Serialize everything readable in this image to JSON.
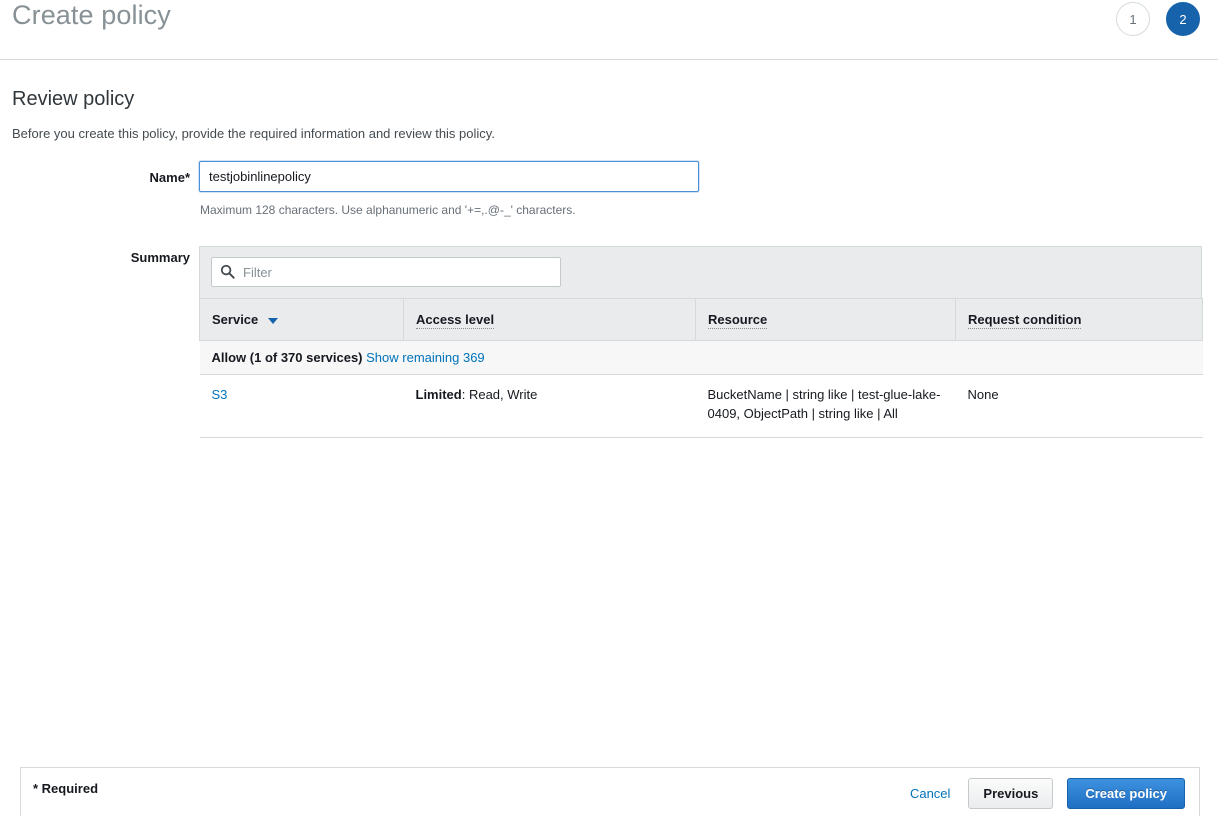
{
  "header": {
    "title": "Create policy",
    "steps": [
      {
        "label": "1",
        "state": "inactive"
      },
      {
        "label": "2",
        "state": "active"
      }
    ],
    "accent_color": "#1763ab",
    "title_color": "#879196"
  },
  "section": {
    "title": "Review policy",
    "description": "Before you create this policy, provide the required information and review this policy."
  },
  "form": {
    "name_label": "Name*",
    "name_value": "testjobinlinepolicy",
    "name_placeholder": "",
    "name_hint": "Maximum 128 characters. Use alphanumeric and '+=,.@-_' characters.",
    "summary_label": "Summary"
  },
  "summary": {
    "filter_placeholder": "Filter",
    "filter_value": "",
    "filter_icon": "search-icon",
    "columns": [
      {
        "label": "Service",
        "sortable": true,
        "sort_direction": "desc",
        "tooltip_underline": false
      },
      {
        "label": "Access level",
        "sortable": false,
        "tooltip_underline": true
      },
      {
        "label": "Resource",
        "sortable": false,
        "tooltip_underline": true
      },
      {
        "label": "Request condition",
        "sortable": false,
        "tooltip_underline": true
      }
    ],
    "group_row": {
      "effect_text": "Allow (1 of 370 services)",
      "show_remaining_link": "Show remaining 369"
    },
    "rows": [
      {
        "service": "S3",
        "access_level_prefix": "Limited",
        "access_level_value": ": Read, Write",
        "resource": "BucketName | string like | test-glue-lake-0409, ObjectPath | string like | All",
        "request_condition": "None"
      }
    ]
  },
  "footer": {
    "required_note": "* Required",
    "cancel_label": "Cancel",
    "previous_label": "Previous",
    "create_label": "Create policy",
    "primary_color": "#1f6fc4",
    "link_color": "#0073bb"
  }
}
